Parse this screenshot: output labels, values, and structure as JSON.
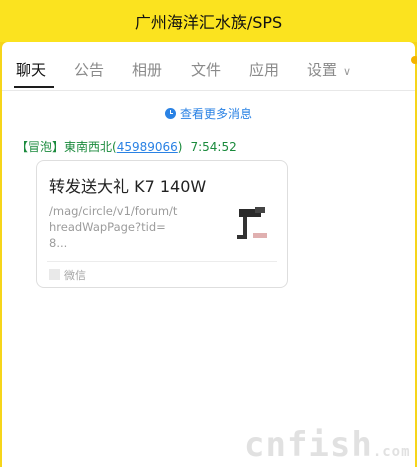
{
  "window": {
    "title": "广州海洋汇水族/SPS"
  },
  "tabs": [
    {
      "label": "聊天"
    },
    {
      "label": "公告"
    },
    {
      "label": "相册"
    },
    {
      "label": "文件"
    },
    {
      "label": "应用"
    },
    {
      "label": "设置"
    }
  ],
  "history_link": "查看更多消息",
  "message": {
    "sender_prefix": "【冒泡】東南西北(",
    "sender_id": "45989066",
    "sender_suffix": ")",
    "time": "7:54:52",
    "card": {
      "title": "转发送大礼 K7 140W",
      "url": "/mag/circle/v1/forum/threadWapPage?tid=8...",
      "source": "微信"
    }
  },
  "watermark": {
    "main": "cnfish",
    "sub": ".com"
  },
  "colors": {
    "title_bg": "#fbe31f",
    "link": "#2a82e4",
    "sender": "#1a8a3c"
  }
}
